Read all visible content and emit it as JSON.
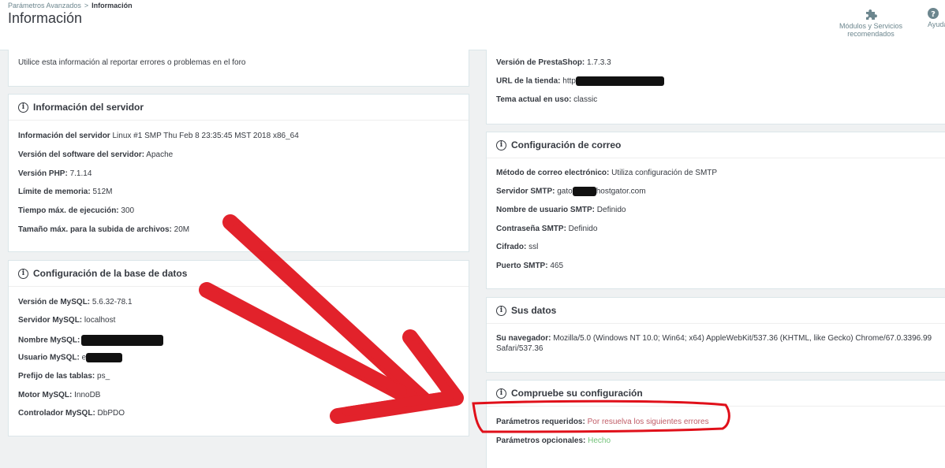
{
  "header": {
    "breadcrumb_parent": "Parámetros Avanzados",
    "breadcrumb_sep": ">",
    "breadcrumb_current": "Información",
    "title": "Información",
    "modules_label": "Módulos y Servicios recomendados",
    "help_label": "Ayuda"
  },
  "left": {
    "intro_text": "Utilice esta información al reportar errores o problemas en el foro",
    "server": {
      "title": "Información del servidor",
      "rows": [
        {
          "label": "Información del servidor",
          "value": " Linux #1 SMP Thu Feb 8 23:35:45 MST 2018 x86_64"
        },
        {
          "label": "Versión del software del servidor:",
          "value": " Apache"
        },
        {
          "label": "Versión PHP:",
          "value": " 7.1.14"
        },
        {
          "label": "Límite de memoria:",
          "value": " 512M"
        },
        {
          "label": "Tiempo máx. de ejecución:",
          "value": " 300"
        },
        {
          "label": "Tamaño máx. para la subida de archivos:",
          "value": " 20M"
        }
      ]
    },
    "db": {
      "title": "Configuración de la base de datos",
      "rows": [
        {
          "label": "Versión de MySQL:",
          "value": " 5.6.32-78.1"
        },
        {
          "label": "Servidor MySQL:",
          "value": " localhost"
        },
        {
          "label": "Nombre MySQL:",
          "value": ""
        },
        {
          "label": "Usuario MySQL:",
          "value": " e"
        },
        {
          "label": "Prefijo de las tablas:",
          "value": " ps_"
        },
        {
          "label": "Motor MySQL:",
          "value": " InnoDB"
        },
        {
          "label": "Controlador MySQL:",
          "value": " DbPDO"
        }
      ]
    }
  },
  "right": {
    "store": {
      "rows": [
        {
          "label": "Versión de PrestaShop:",
          "value": " 1.7.3.3"
        },
        {
          "label": "URL de la tienda:",
          "value": " http"
        },
        {
          "label": "Tema actual en uso:",
          "value": " classic"
        }
      ]
    },
    "mail": {
      "title": "Configuración de correo",
      "rows": [
        {
          "label": "Método de correo electrónico:",
          "value": " Utiliza configuración de SMTP"
        },
        {
          "label": "Servidor SMTP:",
          "value_a": " gato",
          "value_b": "hostgator.com"
        },
        {
          "label": "Nombre de usuario SMTP:",
          "value": " Definido"
        },
        {
          "label": "Contraseña SMTP:",
          "value": " Definido"
        },
        {
          "label": "Cifrado:",
          "value": " ssl"
        },
        {
          "label": "Puerto SMTP:",
          "value": " 465"
        }
      ]
    },
    "yourdata": {
      "title": "Sus datos",
      "browser_label": "Su navegador:",
      "browser_line1": " Mozilla/5.0 (Windows NT 10.0; Win64; x64) AppleWebKit/537.36 (KHTML, like Gecko) Chrome/67.0.3396.99",
      "browser_line2": "Safari/537.36"
    },
    "check": {
      "title": "Compruebe su configuración",
      "required_label": "Parámetros requeridos:",
      "required_value": " Por resuelva los siguientes errores",
      "optional_label": "Parámetros opcionales:",
      "optional_value": " Hecho"
    }
  },
  "colors": {
    "annotation_red": "#e0101a",
    "error_text": "#c05c67",
    "ok_text": "#72c279"
  },
  "icons": {
    "info": "i",
    "modules": "puzzle-icon",
    "help": "help-icon"
  }
}
